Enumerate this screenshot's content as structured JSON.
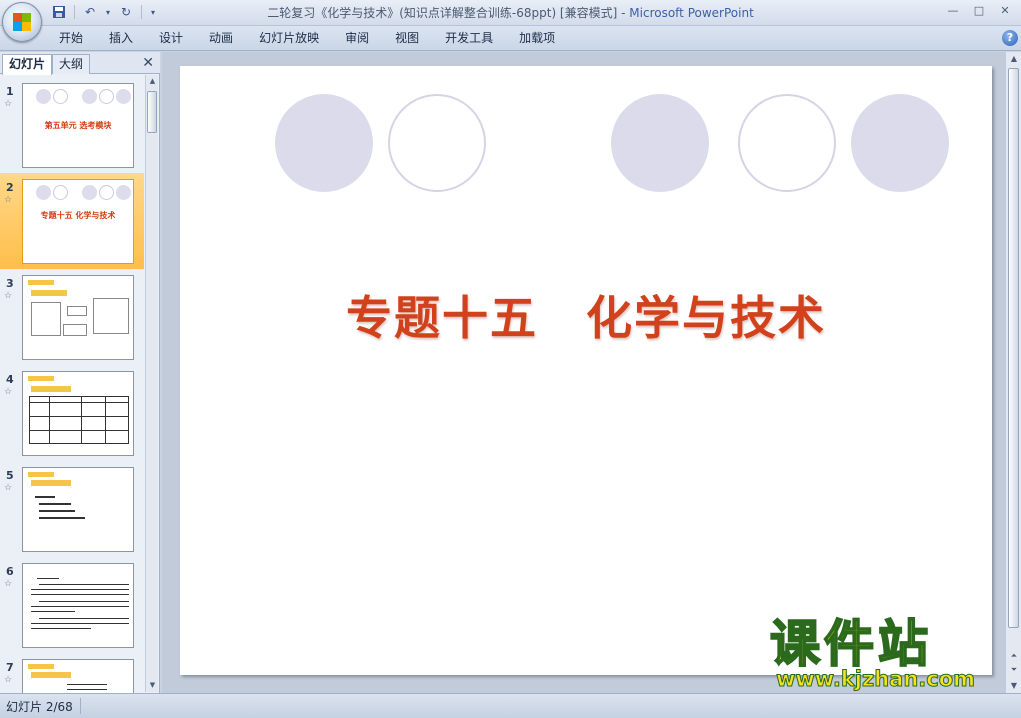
{
  "window": {
    "title_doc": "二轮复习《化学与技术》(知识点详解整合训练-68ppt) [兼容模式]",
    "title_sep": " - ",
    "title_app": "Microsoft PowerPoint"
  },
  "qat": {
    "save_icon": "save-icon",
    "undo_icon": "undo-icon",
    "redo_icon": "redo-icon",
    "customize_icon": "dropdown-icon"
  },
  "ribbon": {
    "tabs": [
      "开始",
      "插入",
      "设计",
      "动画",
      "幻灯片放映",
      "审阅",
      "视图",
      "开发工具",
      "加载项"
    ],
    "help": "?"
  },
  "panel": {
    "tab_slides": "幻灯片",
    "tab_outline": "大纲",
    "close": "✕"
  },
  "thumbnails": [
    {
      "num": "1",
      "title": "第五单元  选考模块"
    },
    {
      "num": "2",
      "title": "专题十五  化学与技术"
    },
    {
      "num": "3"
    },
    {
      "num": "4"
    },
    {
      "num": "5"
    },
    {
      "num": "6"
    },
    {
      "num": "7"
    }
  ],
  "slide": {
    "title": "专题十五　化学与技术"
  },
  "status": {
    "slide_counter": "幻灯片 2/68"
  },
  "watermark": {
    "name": "课件站",
    "url": "www.kjzhan.com"
  }
}
